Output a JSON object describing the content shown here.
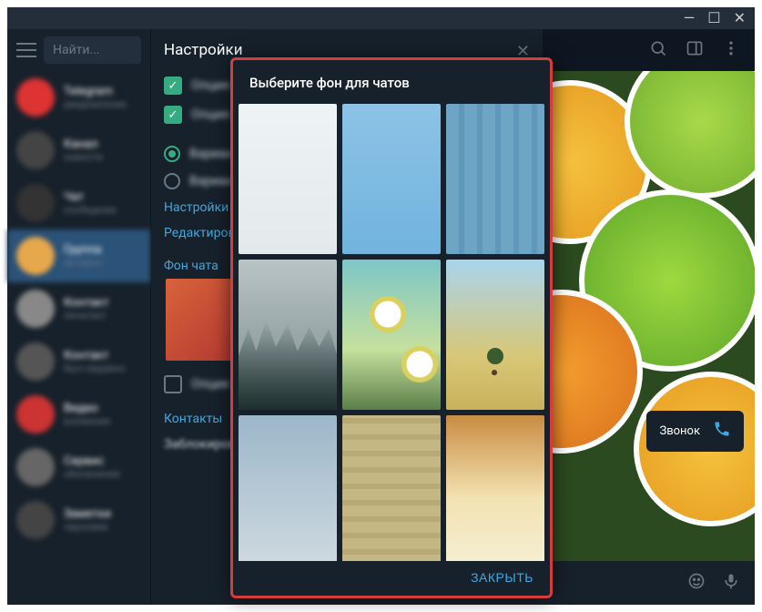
{
  "window": {
    "title_controls": {
      "min": "—",
      "max": "☐",
      "close": "✕"
    }
  },
  "search": {
    "placeholder": "Найти..."
  },
  "settings": {
    "heading": "Настройки",
    "link_settings": "Настройки",
    "link_edit": "Редактировать",
    "section_background": "Фон чата",
    "section_contacts": "Контакты",
    "blocked": "Заблокированные"
  },
  "modal": {
    "title": "Выберите фон для чатов",
    "close_button": "ЗАКРЫТЬ"
  },
  "call": {
    "label": "Звонок"
  },
  "chatlist": {
    "items": [
      {
        "name": "Telegram",
        "sub": "уведомление"
      },
      {
        "name": "Канал",
        "sub": "новости"
      },
      {
        "name": "Чат",
        "sub": "сообщение"
      },
      {
        "name": "Группа",
        "sub": "активно"
      },
      {
        "name": "Контакт",
        "sub": "печатает"
      },
      {
        "name": "Контакт",
        "sub": "был недавно"
      },
      {
        "name": "Видео",
        "sub": "вложение"
      },
      {
        "name": "Сервис",
        "sub": "обновление"
      },
      {
        "name": "Заметки",
        "sub": "черновик"
      }
    ]
  }
}
